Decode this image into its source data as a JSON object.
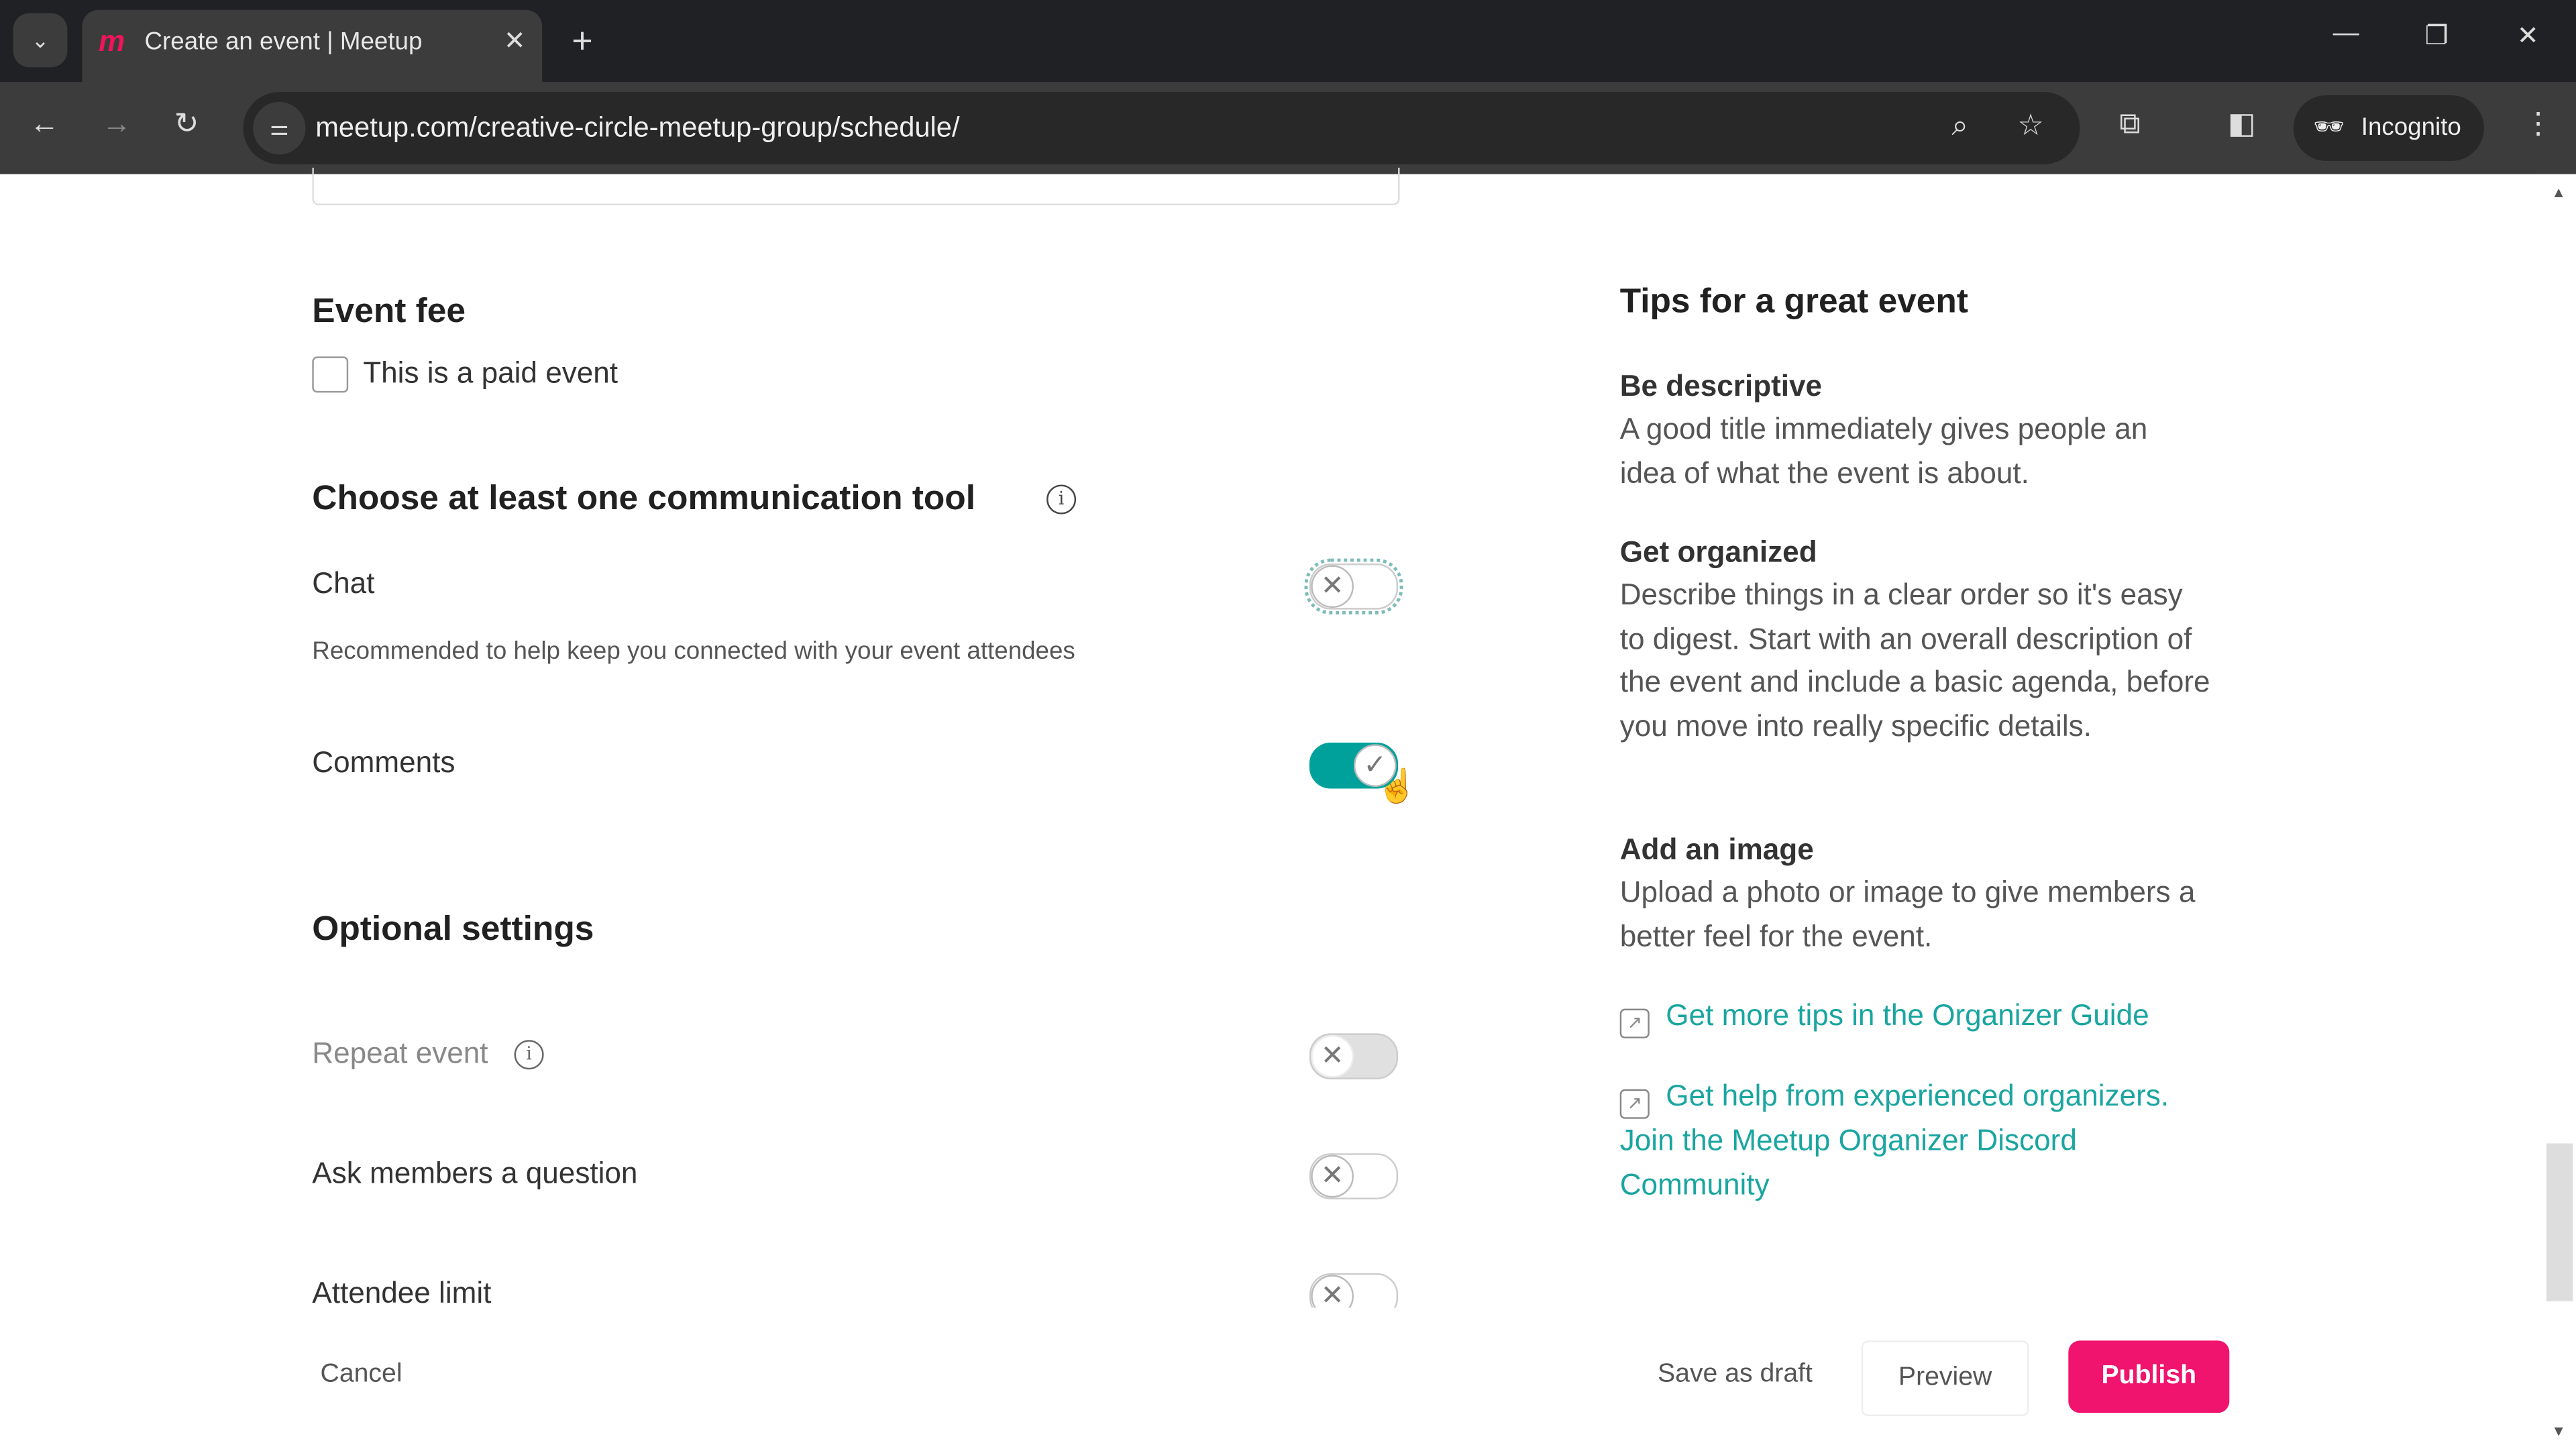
{
  "browser": {
    "tab_title": "Create an event | Meetup",
    "url": "meetup.com/creative-circle-meetup-group/schedule/",
    "profile_label": "Incognito",
    "accent": "#f0145a"
  },
  "form": {
    "event_fee": {
      "heading": "Event fee",
      "paid_label": "This is a paid event",
      "paid_checked": false
    },
    "communication": {
      "heading": "Choose at least one communication tool",
      "chat": {
        "label": "Chat",
        "description": "Recommended to help keep you connected with your event attendees",
        "enabled": false
      },
      "comments": {
        "label": "Comments",
        "enabled": true
      }
    },
    "optional": {
      "heading": "Optional settings",
      "repeat": {
        "label": "Repeat event",
        "enabled": false
      },
      "question": {
        "label": "Ask members a question",
        "enabled": false
      },
      "limit": {
        "label": "Attendee limit",
        "enabled": false
      }
    }
  },
  "tips": {
    "heading": "Tips for a great event",
    "items": [
      {
        "title": "Be descriptive",
        "body": "A good title immediately gives people an idea of what the event is about."
      },
      {
        "title": "Get organized",
        "body": "Describe things in a clear order so it's easy to digest. Start with an overall description of the event and include a basic agenda, before you move into really specific details."
      },
      {
        "title": "Add an image",
        "body": "Upload a photo or image to give members a better feel for the event."
      }
    ],
    "links": [
      "Get more tips in the Organizer Guide",
      "Get help from experienced organizers. Join the Meetup Organizer Discord Community"
    ],
    "link_color": "#1aa5a0"
  },
  "footer": {
    "cancel": "Cancel",
    "save_draft": "Save as draft",
    "preview": "Preview",
    "publish": "Publish",
    "publish_color": "#f0146e"
  }
}
